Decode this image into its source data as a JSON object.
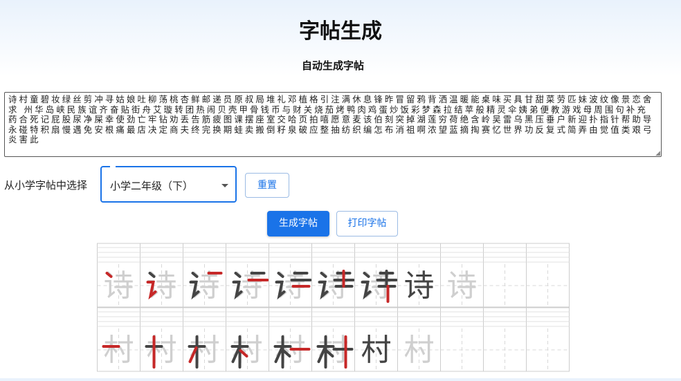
{
  "header": {
    "title": "字帖生成",
    "subtitle": "自动生成字帖"
  },
  "input": {
    "text": "诗村童碧妆绿丝剪冲寻姑娘吐柳荡桃杏鲜邮递员原叔局堆礼邓植格引注满休息锋昨冒留鸦背洒温暖能桌味买具甘甜菜劳匹妹波纹像景恋舍求 州华岛峡民族谊齐奋贴街舟艾璇转团热闹贝壳甲骨钱币与财关烧茄烤鸭肉鸡蛋炒饭彩梦森拉结苹般精灵伞姨弟便教游戏母周围句补充药合死记屁股尿净屎幸使劲亡牢钻劝丢告筋疲图课摆座室交哈页拍嘻愿意麦该伯刻突掉湖莲穷荷绝含岭吴雷乌黑压垂户新迎扑指针帮助导永碰特积扇慢遇免安根痛最店决定商夫终完换期蛙卖搬倒籽泉破应整抽纺织编怎布消祖啊浓望蓝摘掏赛忆世界功反复式简弄由觉值类艰弓炎害此"
  },
  "selector": {
    "label": "从小学字帖中选择",
    "value": "小学二年级（下）"
  },
  "buttons": {
    "reset": "重置",
    "generate": "生成字帖",
    "print": "打印字帖"
  },
  "practice_rows": [
    {
      "char": "诗",
      "steps": 8
    },
    {
      "char": "村",
      "steps": 7
    }
  ],
  "colors": {
    "accent": "#1a73e8",
    "stroke_highlight": "#c62828",
    "stroke_done": "#444444",
    "stroke_ghost": "#cfcfcf",
    "grid": "#cccccc"
  }
}
